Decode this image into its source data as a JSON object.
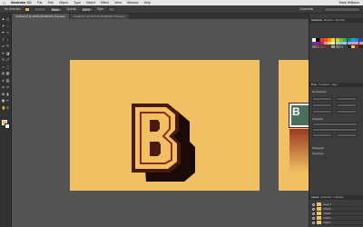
{
  "menubar": {
    "apple": "",
    "items": [
      "Illustrator CC",
      "File",
      "Edit",
      "Object",
      "Type",
      "Select",
      "Effect",
      "View",
      "Window",
      "Help"
    ],
    "right": [
      "Mark Williams"
    ]
  },
  "control": {
    "label": "No Selection",
    "stroke_field": "",
    "basic": "Basic",
    "opacity_label": "Opacity:",
    "opacity_value": "100%",
    "style_label": "Style:",
    "workspace": "Essentials"
  },
  "tabs": [
    {
      "label": "Untitled-8* @ 200% (RGB/GPU Preview)",
      "active": true
    },
    {
      "label": "Untitled-6* @ 66.67% (RGB/GPU Preview)",
      "active": false
    }
  ],
  "tools": {
    "icons": [
      "selection-icon",
      "direct-selection-icon",
      "magic-wand-icon",
      "lasso-icon",
      "pen-icon",
      "curvature-icon",
      "type-icon",
      "line-icon",
      "rectangle-icon",
      "paintbrush-icon",
      "pencil-icon",
      "eraser-icon",
      "rotate-icon",
      "scale-icon",
      "width-icon",
      "free-transform-icon",
      "shape-builder-icon",
      "perspective-icon",
      "mesh-icon",
      "gradient-icon",
      "eyedropper-icon",
      "blend-icon",
      "symbol-sprayer-icon",
      "graph-icon",
      "artboard-icon",
      "slice-icon",
      "hand-icon",
      "zoom-icon"
    ],
    "fill_color": "#f0b84f",
    "stroke_color": "#ffffff"
  },
  "artwork": {
    "letter": "B",
    "fill": "#f0c062",
    "letter_fill": "#f0c062",
    "outline": "#4a1a12",
    "inline": "#8b2b1f",
    "extrude": "#1a0b08"
  },
  "panels": {
    "top_tabs": [
      "Swatches",
      "Brushes",
      "Symbols"
    ],
    "appearance_tabs": [
      "Prop",
      "Transform",
      "Align"
    ],
    "appearance_title": "Appearance",
    "path_label": "No Selection",
    "character_label": "Character",
    "paragraph_label": "Paragraph",
    "opentype_label": "OpenType",
    "layers_tabs": [
      "Layers",
      "Artboards",
      "Libraries"
    ],
    "layers": [
      "Layer 1",
      "<Path>",
      "<Path>",
      "<Path>",
      "<Path>"
    ],
    "swatch_colors": [
      "#ffffff",
      "#000000",
      "#e53935",
      "#f4511e",
      "#fb8c00",
      "#fdd835",
      "#c0ca33",
      "#7cb342",
      "#43a047",
      "#00897b",
      "#00acc1",
      "#1e88e5",
      "#3949ab",
      "#5e35b1",
      "#8e24aa",
      "#d81b60",
      "#ef9a9a",
      "#ffcc80",
      "#fff59d",
      "#a5d6a7",
      "#80cbc4",
      "#81d4fa",
      "#9fa8da",
      "#ce93d8",
      "#f48fb1",
      "#bcaaa4",
      "#8d6e63",
      "#795548",
      "#6d4c41",
      "#5d4037",
      "#4e342e",
      "#9e9e9e",
      "#757575",
      "#616161",
      "#424242",
      "#212121",
      "#f0c062",
      "#8b2b1f",
      "#4a1a12"
    ]
  }
}
